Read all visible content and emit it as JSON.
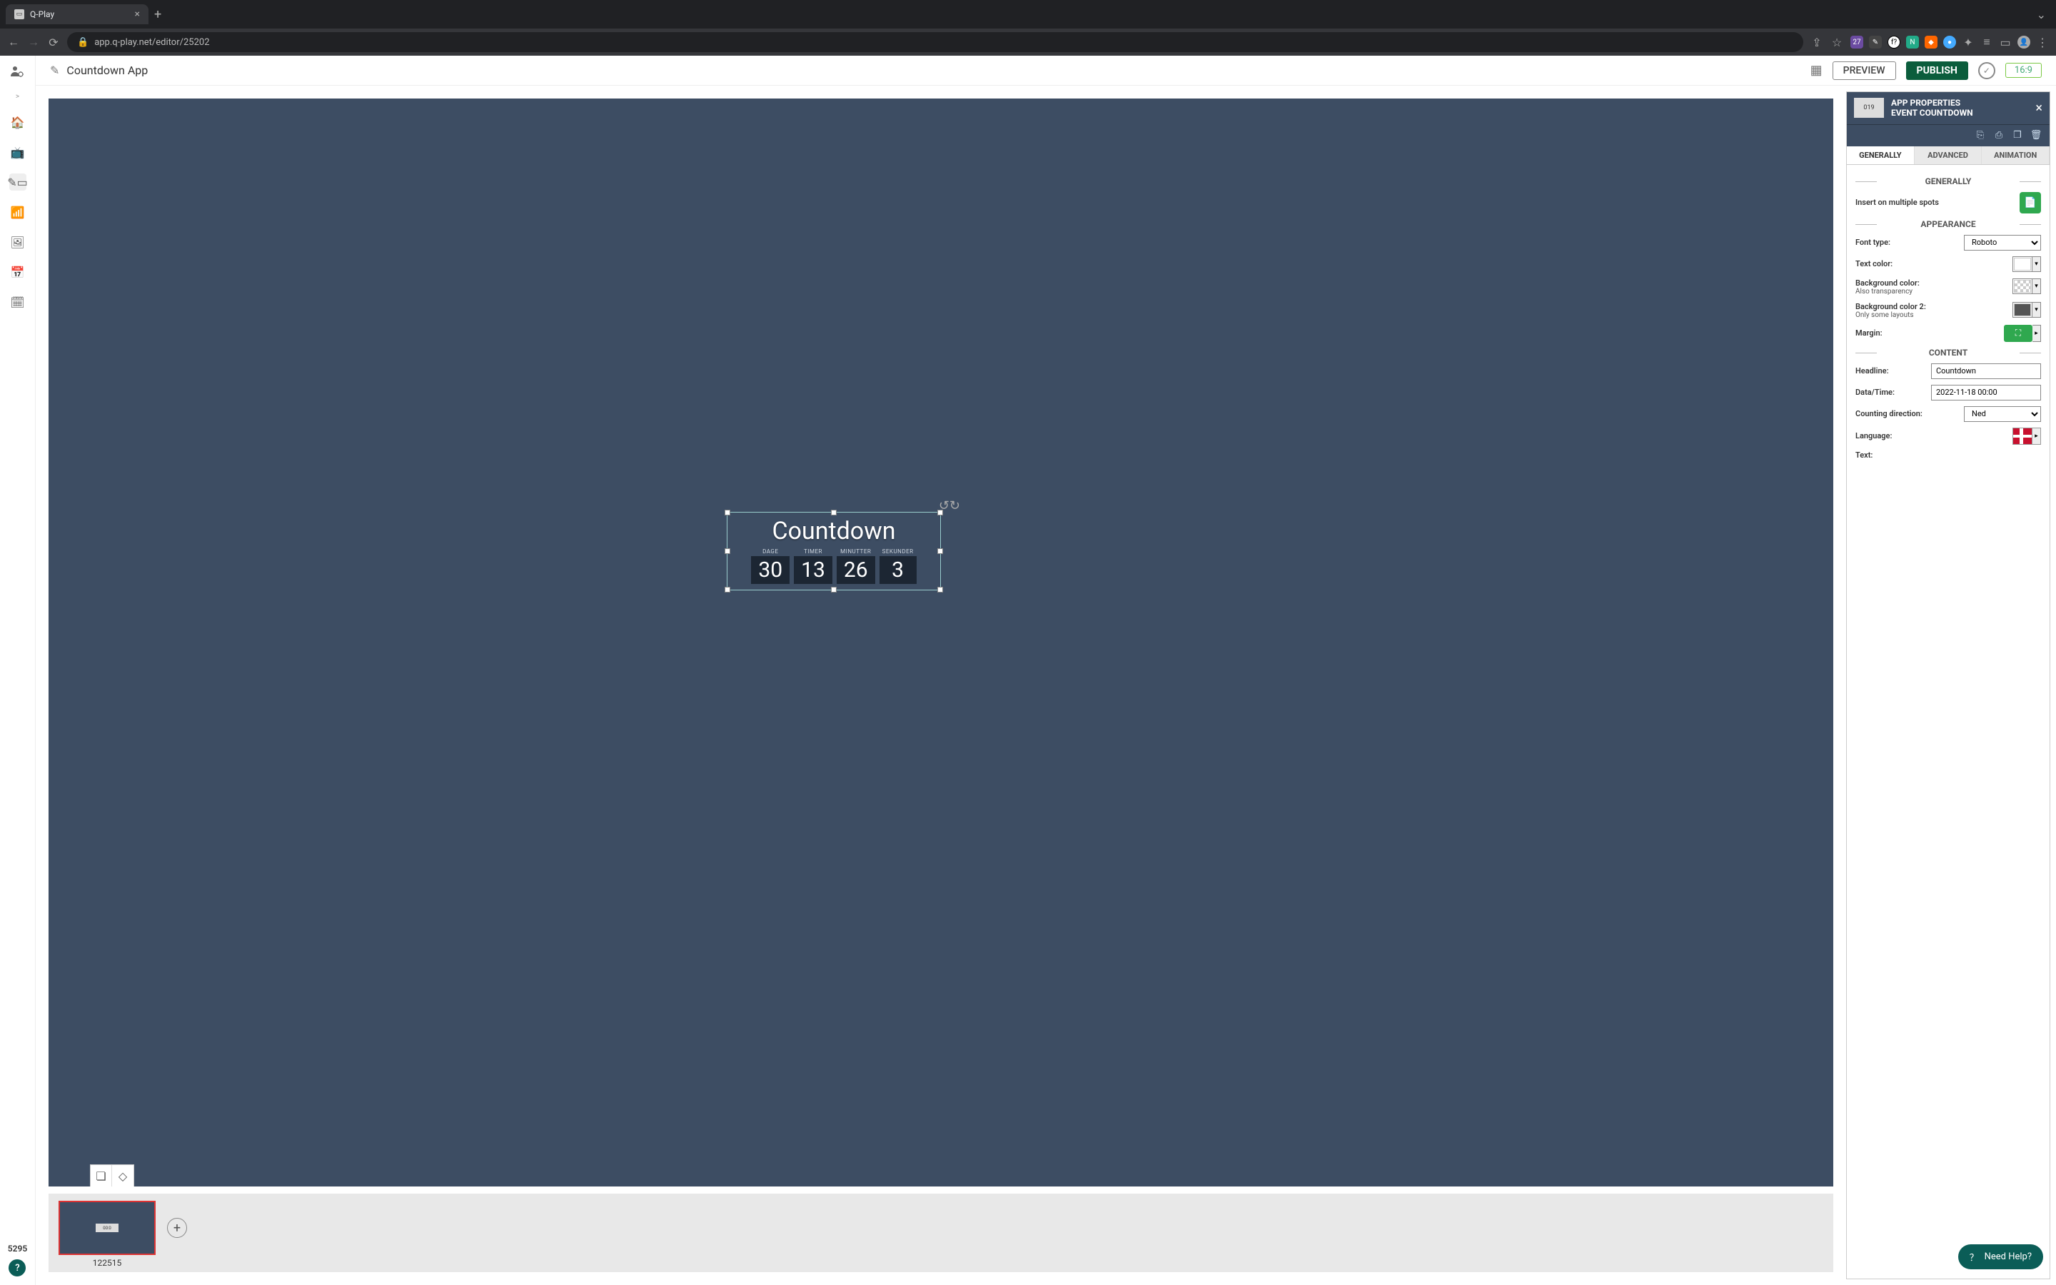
{
  "browser": {
    "tab_title": "Q-Play",
    "url": "app.q-play.net/editor/25202",
    "ext_badge": "27"
  },
  "left_rail": {
    "counter": "5295"
  },
  "topbar": {
    "doc_title": "Countdown App",
    "preview": "PREVIEW",
    "publish": "PUBLISH",
    "aspect": "16:9"
  },
  "countdown": {
    "headline": "Countdown",
    "units": [
      {
        "label": "DAGE",
        "value": "30"
      },
      {
        "label": "TIMER",
        "value": "13"
      },
      {
        "label": "MINUTTER",
        "value": "26"
      },
      {
        "label": "SEKUNDER",
        "value": "3"
      }
    ]
  },
  "slides": {
    "thumb_label": "122515"
  },
  "props": {
    "title1": "APP PROPERTIES",
    "title2": "EVENT COUNTDOWN",
    "tabs": {
      "generally": "GENERALLY",
      "advanced": "ADVANCED",
      "animation": "ANIMATION"
    },
    "sections": {
      "generally_head": "GENERALLY",
      "appearance": "APPEARANCE",
      "content": "CONTENT"
    },
    "labels": {
      "insert_multi": "Insert on multiple spots",
      "font_type": "Font type:",
      "text_color": "Text color:",
      "bg1a": "Background color:",
      "bg1b": "Also transparency",
      "bg2a": "Background color 2:",
      "bg2b": "Only some layouts",
      "margin": "Margin:",
      "headline": "Headline:",
      "datetime": "Data/Time:",
      "direction": "Counting direction:",
      "language": "Language:",
      "text": "Text:"
    },
    "values": {
      "font": "Roboto",
      "headline": "Countdown",
      "datetime": "2022-11-18 00:00",
      "direction": "Ned"
    }
  },
  "need_help": "Need Help?"
}
